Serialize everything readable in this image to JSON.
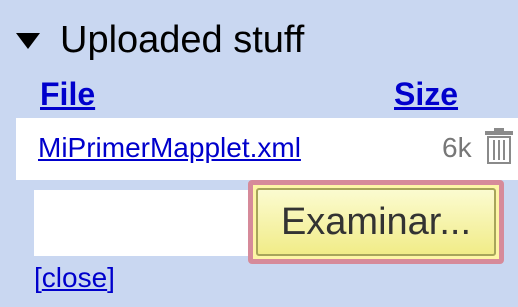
{
  "panel": {
    "title": "Uploaded stuff",
    "columns": {
      "file": "File",
      "size": "Size"
    },
    "files": [
      {
        "name": "MiPrimerMapplet.xml",
        "size": "6k"
      }
    ],
    "upload": {
      "browse_label": "Examinar...",
      "input_value": ""
    },
    "close": {
      "open_bracket": "[",
      "label": "close",
      "close_bracket": "]"
    }
  },
  "icons": {
    "collapse": "triangle-down-icon",
    "delete": "trash-icon"
  },
  "colors": {
    "panel_background": "#c9d7f1",
    "link": "#0000cc",
    "button_fill": "#fdf5a6",
    "button_focus_border": "#d68a9a"
  }
}
